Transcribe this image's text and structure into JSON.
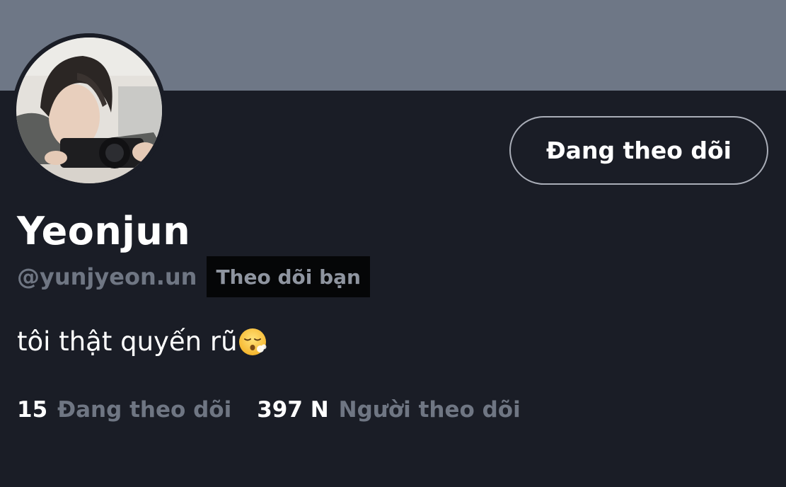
{
  "profile": {
    "display_name": "Yeonjun",
    "handle": "@yunjyeon.un",
    "follows_you_badge": "Theo dõi bạn",
    "bio": "tôi thật quyến rũ",
    "bio_emoji": "face-exhaling-emoji",
    "follow_button_label": "Đang theo dõi",
    "avatar": "profile-photo-person-with-camera"
  },
  "stats": [
    {
      "count": "15",
      "label": "Đang theo dõi"
    },
    {
      "count": "397 N",
      "label": "Người theo dõi"
    }
  ],
  "colors": {
    "banner": "#6e7786",
    "background": "#1a1d26",
    "muted_text": "#6f7683",
    "primary_text": "#ffffff",
    "badge_background": "#050607",
    "button_border": "#a9adb7"
  }
}
